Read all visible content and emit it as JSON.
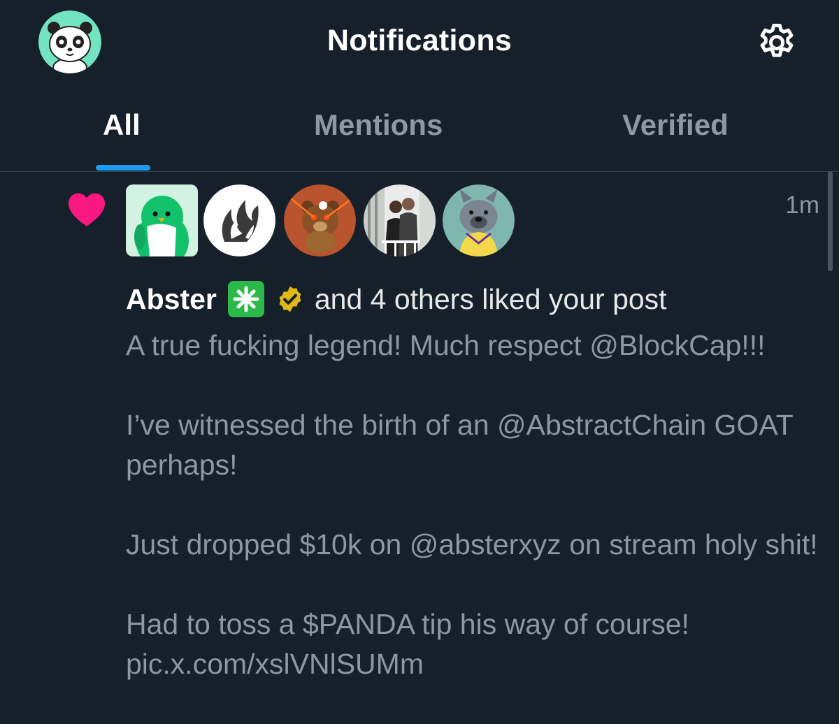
{
  "header": {
    "title": "Notifications",
    "avatar_icon": "panda-avatar",
    "settings_icon": "gear-icon"
  },
  "tabs": [
    {
      "label": "All",
      "active": true
    },
    {
      "label": "Mentions",
      "active": false
    },
    {
      "label": "Verified",
      "active": false
    }
  ],
  "notification": {
    "type_icon": "heart-icon",
    "type_color": "#f91880",
    "time": "1m",
    "avatars": [
      "penguin-avatar",
      "brand-logo-avatar",
      "cartoon-bear-avatar",
      "couple-photo-avatar",
      "bulldog-avatar"
    ],
    "actor_name": "Abster",
    "actor_badge": "sparkle-badge",
    "actor_verified_color": "#e2b719",
    "action_text": "and 4 others liked your post",
    "post_lines": [
      "A true fucking legend! Much respect @BlockCap!!!",
      "I’ve witnessed the birth of an @AbstractChain GOAT perhaps!",
      "Just dropped $10k on @absterxyz on stream holy shit!",
      "Had to toss a $PANDA tip his way of course! pic.x.com/xslVNlSUMm"
    ]
  },
  "colors": {
    "background": "#15202b",
    "accent": "#1d9bf0",
    "secondary_text": "#8b98a5"
  }
}
